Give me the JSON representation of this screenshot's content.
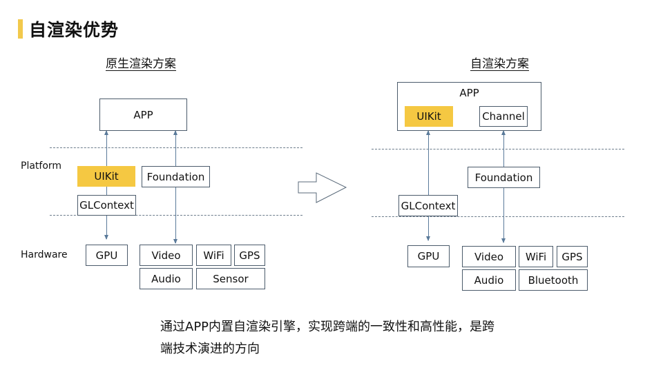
{
  "page": {
    "title": "自渲染优势",
    "accent_color": "#f5c842"
  },
  "left": {
    "subtitle": "原生渲染方案",
    "layers": {
      "platform": "Platform",
      "hardware": "Hardware"
    },
    "app": "APP",
    "platform_boxes": {
      "uikit": "UIKit",
      "foundation": "Foundation",
      "glcontext": "GLContext"
    },
    "hardware_boxes": {
      "gpu": "GPU",
      "video": "Video",
      "wifi": "WiFi",
      "gps": "GPS",
      "audio": "Audio",
      "sensor": "Sensor"
    }
  },
  "right": {
    "subtitle": "自渲染方案",
    "app": "APP",
    "app_inner": {
      "uikit": "UIKit",
      "channel": "Channel"
    },
    "platform_boxes": {
      "foundation": "Foundation",
      "glcontext": "GLContext"
    },
    "hardware_boxes": {
      "gpu": "GPU",
      "video": "Video",
      "wifi": "WiFi",
      "gps": "GPS",
      "audio": "Audio",
      "bluetooth": "Bluetooth"
    }
  },
  "caption": {
    "line1": "通过APP内置自渲染引擎，实现跨端的一致性和高性能，是跨",
    "line2": "端技术演进的方向"
  }
}
